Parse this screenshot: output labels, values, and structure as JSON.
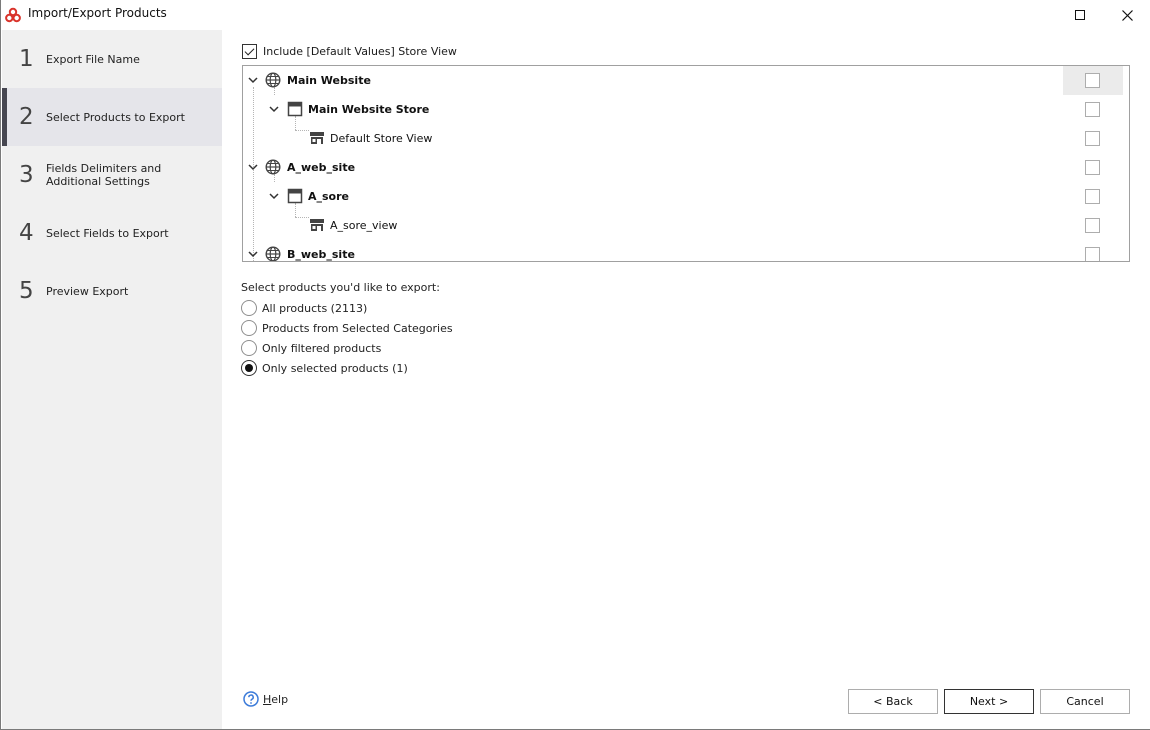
{
  "window": {
    "title": "Import/Export Products",
    "app_icon": "app-logo-icon",
    "maximize_icon": "maximize-icon",
    "close_icon": "close-icon",
    "accent_color": "#d9332b"
  },
  "sidebar": {
    "active_index": 1,
    "steps": [
      {
        "number": "1",
        "label": "Export File Name"
      },
      {
        "number": "2",
        "label": "Select Products to Export"
      },
      {
        "number": "3",
        "label": "Fields Delimiters and Additional Settings"
      },
      {
        "number": "4",
        "label": "Select Fields to Export"
      },
      {
        "number": "5",
        "label": "Preview Export"
      }
    ]
  },
  "main": {
    "include_default": {
      "label": "Include [Default Values] Store View",
      "checked": true
    },
    "tree": {
      "nodes": [
        {
          "label": "Main Website",
          "type": "website",
          "icon": "globe-icon",
          "level": 0,
          "expanded": true,
          "checked": false
        },
        {
          "label": "Main Website Store",
          "type": "store",
          "icon": "store-window-icon",
          "level": 1,
          "expanded": true,
          "checked": false
        },
        {
          "label": "Default Store View",
          "type": "store-view",
          "icon": "storefront-icon",
          "level": 2,
          "checked": false
        },
        {
          "label": "A_web_site",
          "type": "website",
          "icon": "globe-icon",
          "level": 0,
          "expanded": true,
          "checked": false
        },
        {
          "label": "A_sore",
          "type": "store",
          "icon": "store-window-icon",
          "level": 1,
          "expanded": true,
          "checked": false
        },
        {
          "label": "A_sore_view",
          "type": "store-view",
          "icon": "storefront-icon",
          "level": 2,
          "checked": false
        },
        {
          "label": "B_web_site",
          "type": "website",
          "icon": "globe-icon",
          "level": 0,
          "expanded": true,
          "checked": false
        }
      ]
    },
    "select_label": "Select products you'd like to export:",
    "options": [
      {
        "label": "All products (2113)",
        "checked": false
      },
      {
        "label": "Products from Selected Categories",
        "checked": false
      },
      {
        "label": "Only filtered products",
        "checked": false
      },
      {
        "label": "Only selected products (1)",
        "checked": true
      }
    ]
  },
  "footer": {
    "help_label": "Help",
    "back_label": "< Back",
    "next_label": "Next >",
    "cancel_label": "Cancel"
  }
}
